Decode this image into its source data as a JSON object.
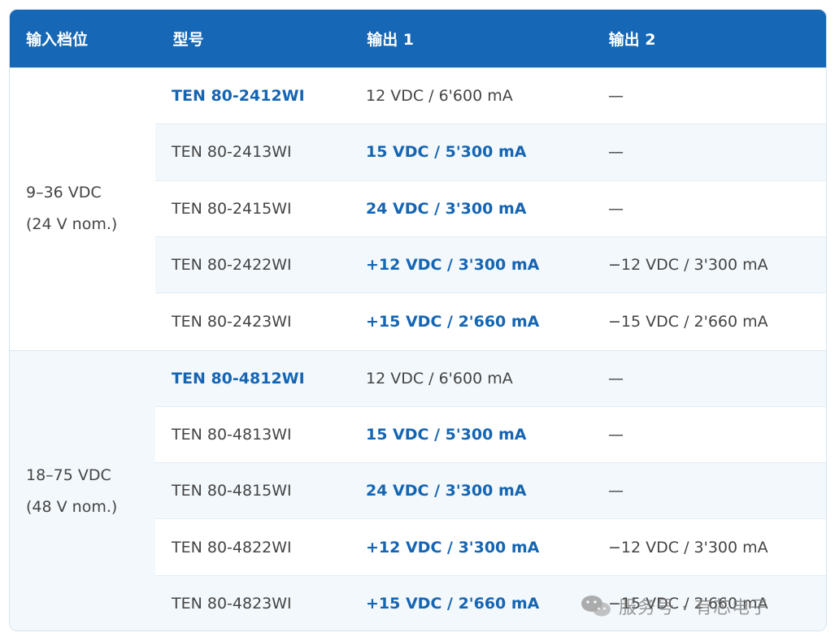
{
  "header": {
    "col1": "输入档位",
    "col2": "型号",
    "col3": "输出 1",
    "col4": "输出 2"
  },
  "groups": [
    {
      "input_range": "9–36 VDC",
      "input_nominal": "(24 V nom.)",
      "rows": [
        {
          "model": "TEN 80-2412WI",
          "out1": "12 VDC / 6'600 mA",
          "out2": "—"
        },
        {
          "model": "TEN 80-2413WI",
          "out1": "15 VDC / 5'300 mA",
          "out2": "—"
        },
        {
          "model": "TEN 80-2415WI",
          "out1": "24 VDC / 3'300 mA",
          "out2": "—"
        },
        {
          "model": "TEN 80-2422WI",
          "out1": "+12 VDC / 3'300 mA",
          "out2": "−12 VDC / 3'300 mA"
        },
        {
          "model": "TEN 80-2423WI",
          "out1": "+15 VDC / 2'660 mA",
          "out2": "−15 VDC / 2'660 mA"
        }
      ]
    },
    {
      "input_range": "18–75 VDC",
      "input_nominal": "(48 V nom.)",
      "rows": [
        {
          "model": "TEN 80-4812WI",
          "out1": "12 VDC / 6'600 mA",
          "out2": "—"
        },
        {
          "model": "TEN 80-4813WI",
          "out1": "15 VDC / 5'300 mA",
          "out2": "—"
        },
        {
          "model": "TEN 80-4815WI",
          "out1": "24 VDC / 3'300 mA",
          "out2": "—"
        },
        {
          "model": "TEN 80-4822WI",
          "out1": "+12 VDC / 3'300 mA",
          "out2": "−12 VDC / 3'300 mA"
        },
        {
          "model": "TEN 80-4823WI",
          "out1": "+15 VDC / 2'660 mA",
          "out2": "−15 VDC / 2'660 mA"
        }
      ]
    }
  ],
  "watermark": {
    "text": "服务号 · 有芯电子",
    "icon": "wechat-icon"
  },
  "colors": {
    "header_bg": "#1667b5",
    "highlight": "#1565b3",
    "stripe": "#f3f8fc",
    "text": "#444444"
  }
}
